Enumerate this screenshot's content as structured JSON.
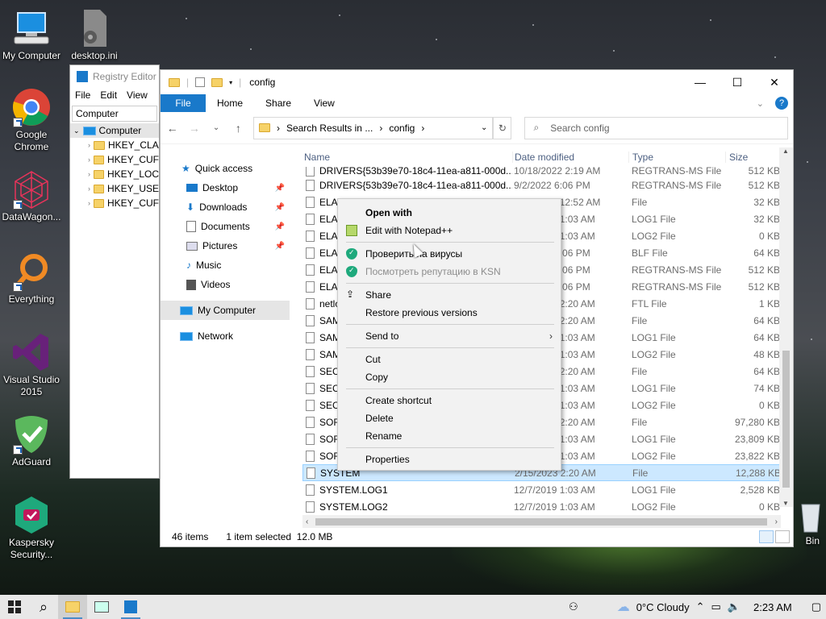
{
  "desktop": {
    "icons": [
      {
        "label": "My Computer",
        "icon": "computer-icon"
      },
      {
        "label": "desktop.ini",
        "icon": "gear-file-icon"
      },
      {
        "label": "Google Chrome",
        "icon": "chrome-icon"
      },
      {
        "label": "DataWagon...",
        "icon": "datawagon-icon"
      },
      {
        "label": "Everything",
        "icon": "everything-icon"
      },
      {
        "label": "Visual Studio 2015",
        "icon": "visual-studio-icon"
      },
      {
        "label": "AdGuard",
        "icon": "adguard-icon"
      },
      {
        "label": "Kaspersky Security...",
        "icon": "kaspersky-icon"
      },
      {
        "label": "Bin",
        "icon": "recycle-bin-icon"
      }
    ]
  },
  "regedit": {
    "title": "Registry Editor",
    "menu": [
      "File",
      "Edit",
      "View"
    ],
    "address": "Computer",
    "tree_root": "Computer",
    "tree": [
      "HKEY_CLA",
      "HKEY_CUF",
      "HKEY_LOC",
      "HKEY_USE",
      "HKEY_CUF"
    ]
  },
  "explorer": {
    "title": "config",
    "ribbon": {
      "file": "File",
      "tabs": [
        "Home",
        "Share",
        "View"
      ]
    },
    "address": {
      "crumb1": "Search Results in ...",
      "sep": "›",
      "crumb2": "config"
    },
    "search_placeholder": "Search config",
    "nav": [
      {
        "label": "Quick access",
        "pinned": false
      },
      {
        "label": "Desktop",
        "pinned": true
      },
      {
        "label": "Downloads",
        "pinned": true
      },
      {
        "label": "Documents",
        "pinned": true
      },
      {
        "label": "Pictures",
        "pinned": true
      },
      {
        "label": "Music",
        "pinned": false
      },
      {
        "label": "Videos",
        "pinned": false
      },
      {
        "label": "My Computer",
        "pinned": false
      },
      {
        "label": "Network",
        "pinned": false
      }
    ],
    "columns": {
      "name": "Name",
      "date": "Date modified",
      "type": "Type",
      "size": "Size"
    },
    "files": [
      {
        "name": "DRIVERS{53b39e70-18c4-11ea-a811-000d...",
        "date": "10/18/2022 2:19 AM",
        "type": "REGTRANS-MS File",
        "size": "512 KB",
        "partial": true
      },
      {
        "name": "DRIVERS{53b39e70-18c4-11ea-a811-000d...",
        "date": "9/2/2022 6:06 PM",
        "type": "REGTRANS-MS File",
        "size": "512 KB"
      },
      {
        "name": "ELAM",
        "date": "2/15/2023 12:52 AM",
        "type": "File",
        "size": "32 KB"
      },
      {
        "name": "ELAM.LOG1",
        "date": "12/7/2019 1:03 AM",
        "type": "LOG1 File",
        "size": "32 KB"
      },
      {
        "name": "ELAM.LOG2",
        "date": "12/7/2019 1:03 AM",
        "type": "LOG2 File",
        "size": "0 KB"
      },
      {
        "name": "ELAM{...}.TM.blf",
        "date": "9/2/2022 6:06 PM",
        "type": "BLF File",
        "size": "64 KB"
      },
      {
        "name": "ELAM{...}.TMContainer00000000000000000001.regtrans-ms",
        "date": "9/2/2022 6:06 PM",
        "type": "REGTRANS-MS File",
        "size": "512 KB"
      },
      {
        "name": "ELAM{...}.TMContainer00000000000000000002.regtrans-ms",
        "date": "9/2/2022 6:06 PM",
        "type": "REGTRANS-MS File",
        "size": "512 KB"
      },
      {
        "name": "netlogon.ftl",
        "date": "2/15/2023 2:20 AM",
        "type": "FTL File",
        "size": "1 KB"
      },
      {
        "name": "SAM",
        "date": "2/15/2023 2:20 AM",
        "type": "File",
        "size": "64 KB"
      },
      {
        "name": "SAM.LOG1",
        "date": "12/7/2019 1:03 AM",
        "type": "LOG1 File",
        "size": "64 KB"
      },
      {
        "name": "SAM.LOG2",
        "date": "12/7/2019 1:03 AM",
        "type": "LOG2 File",
        "size": "48 KB"
      },
      {
        "name": "SECURITY",
        "date": "2/15/2023 2:20 AM",
        "type": "File",
        "size": "64 KB"
      },
      {
        "name": "SECURITY.LOG1",
        "date": "12/7/2019 1:03 AM",
        "type": "LOG1 File",
        "size": "74 KB"
      },
      {
        "name": "SECURITY.LOG2",
        "date": "12/7/2019 1:03 AM",
        "type": "LOG2 File",
        "size": "0 KB"
      },
      {
        "name": "SOFTWARE",
        "date": "2/15/2023 2:20 AM",
        "type": "File",
        "size": "97,280 KB"
      },
      {
        "name": "SOFTWARE.LOG1",
        "date": "12/7/2019 1:03 AM",
        "type": "LOG1 File",
        "size": "23,809 KB"
      },
      {
        "name": "SOFTWARE.LOG2",
        "date": "12/7/2019 1:03 AM",
        "type": "LOG2 File",
        "size": "23,822 KB"
      },
      {
        "name": "SYSTEM",
        "date": "2/15/2023 2:20 AM",
        "type": "File",
        "size": "12,288 KB",
        "selected": true
      },
      {
        "name": "SYSTEM.LOG1",
        "date": "12/7/2019 1:03 AM",
        "type": "LOG1 File",
        "size": "2,528 KB"
      },
      {
        "name": "SYSTEM.LOG2",
        "date": "12/7/2019 1:03 AM",
        "type": "LOG2 File",
        "size": "0 KB"
      }
    ],
    "status": {
      "count": "46 items",
      "selected": "1 item selected",
      "size": "12.0 MB"
    }
  },
  "context_menu": {
    "items": [
      {
        "label": "Open with",
        "bold": true
      },
      {
        "label": "Edit with Notepad++",
        "icon": "notepad-plus-plus-icon"
      },
      {
        "sep": true
      },
      {
        "label": "Проверить на вирусы",
        "icon": "kaspersky-shield-icon"
      },
      {
        "label": "Посмотреть репутацию в KSN",
        "icon": "kaspersky-shield-icon",
        "disabled": true
      },
      {
        "sep": true
      },
      {
        "label": "Share",
        "icon": "share-icon"
      },
      {
        "label": "Restore previous versions"
      },
      {
        "sep": true
      },
      {
        "label": "Send to",
        "submenu": true
      },
      {
        "sep": true
      },
      {
        "label": "Cut"
      },
      {
        "label": "Copy"
      },
      {
        "sep": true
      },
      {
        "label": "Create shortcut"
      },
      {
        "label": "Delete"
      },
      {
        "label": "Rename"
      },
      {
        "sep": true
      },
      {
        "label": "Properties"
      }
    ]
  },
  "taskbar": {
    "weather": "0°C  Cloudy",
    "time": "2:23 AM"
  }
}
